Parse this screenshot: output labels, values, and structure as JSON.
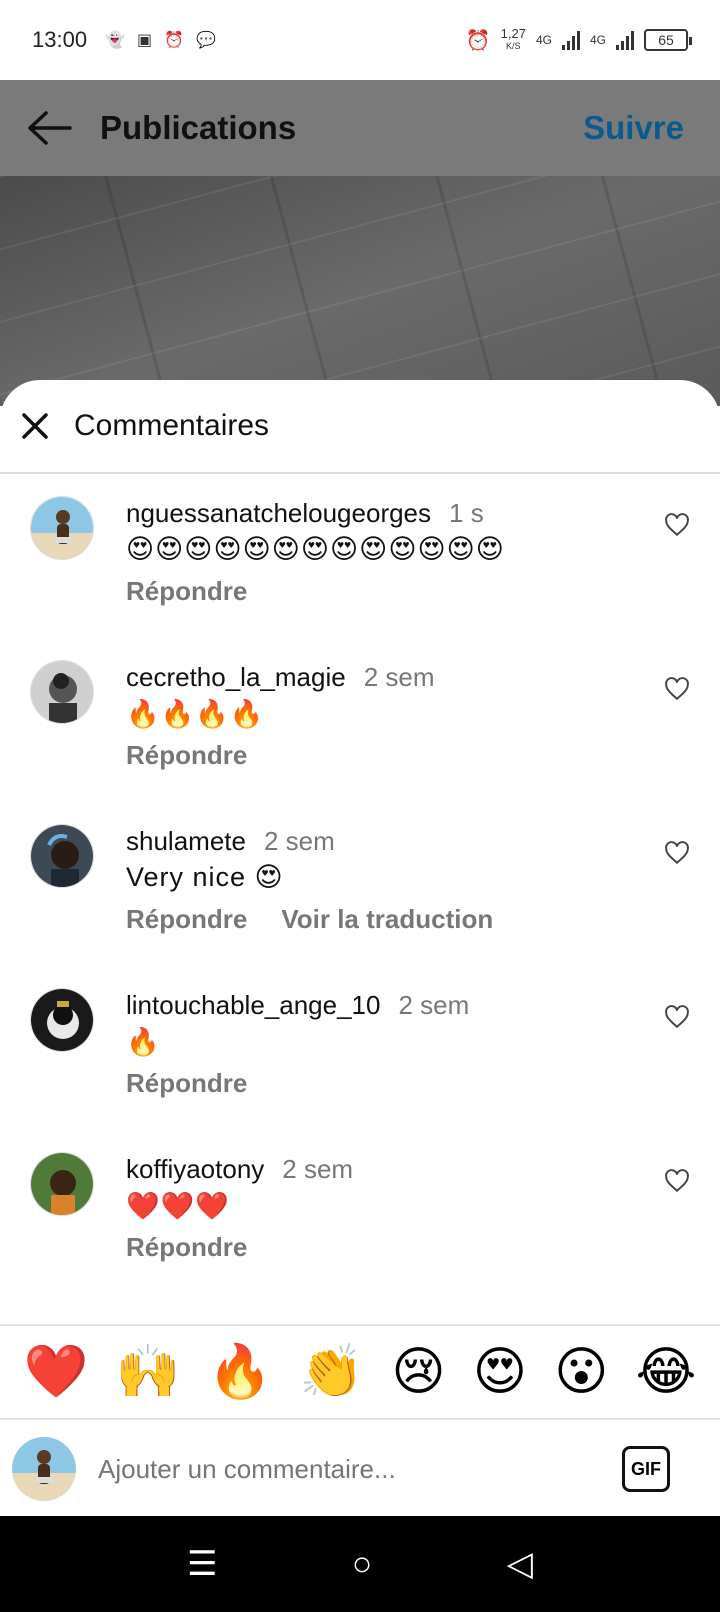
{
  "status": {
    "time": "13:00",
    "speed_value": "1,27",
    "speed_unit": "K/S",
    "net1": "4G",
    "net2": "4G",
    "battery": "65"
  },
  "header": {
    "title": "Publications",
    "follow_label": "Suivre"
  },
  "sheet": {
    "title": "Commentaires"
  },
  "comments": [
    {
      "user": "nguessanatchelougeorges",
      "time": "1 s",
      "text": "😍😍😍😍😍😍😍😍😍😍😍😍😍",
      "reply_label": "Répondre",
      "translate_label": ""
    },
    {
      "user": "cecretho_la_magie",
      "time": "2 sem",
      "text": "🔥🔥🔥🔥",
      "reply_label": "Répondre",
      "translate_label": ""
    },
    {
      "user": "shulamete",
      "time": "2 sem",
      "text": "Very nice 😍",
      "reply_label": "Répondre",
      "translate_label": "Voir la traduction"
    },
    {
      "user": "lintouchable_ange_10",
      "time": "2 sem",
      "text": "🔥",
      "reply_label": "Répondre",
      "translate_label": ""
    },
    {
      "user": "koffiyaotony",
      "time": "2 sem",
      "text": "❤️❤️❤️",
      "reply_label": "Répondre",
      "translate_label": ""
    }
  ],
  "reactions": [
    "❤️",
    "🙌",
    "🔥",
    "👏",
    "😢",
    "😍",
    "😮",
    "😂"
  ],
  "comment_input": {
    "placeholder": "Ajouter un commentaire...",
    "gif_label": "GIF"
  },
  "colors": {
    "accent": "#0a5a8f",
    "header_bg": "#7a7a7a",
    "muted_text": "#777777"
  }
}
